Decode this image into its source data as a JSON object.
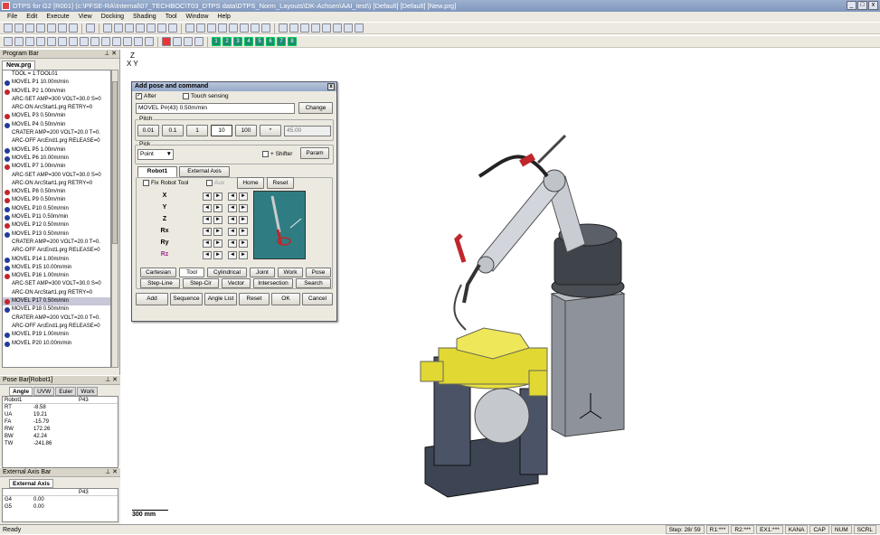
{
  "window": {
    "title": "DTPS for G2 [R001] (c:\\PFSE-RA\\Internal\\07_TECHBOC\\T03_DTPS data\\DTPS_Norm_Layouts\\DK-Achsen\\AAI_test\\) [Default] [Default] [New.prg]",
    "controls": [
      "_",
      "□",
      "x"
    ]
  },
  "menu": [
    "File",
    "Edit",
    "Execute",
    "View",
    "Docking",
    "Shading",
    "Tool",
    "Window",
    "Help"
  ],
  "toolbar2_numbers": [
    "1",
    "2",
    "3",
    "4",
    "5",
    "6",
    "7",
    "8"
  ],
  "program_bar": {
    "title": "Program Bar",
    "tab": "New.prg",
    "lines": [
      {
        "text": "TOOL = 1:TOOL01",
        "dot": ""
      },
      {
        "text": "MOVEL P1 10.00m/min",
        "dot": "blue"
      },
      {
        "text": "MOVEL P2 1.00m/min",
        "dot": "red"
      },
      {
        "text": "ARC-SET AMP=300 VOLT=30.0 S=0",
        "dot": ""
      },
      {
        "text": "ARC-ON ArcStart1.prg RETRY=0",
        "dot": ""
      },
      {
        "text": "MOVEL P3 0.50m/min",
        "dot": "red"
      },
      {
        "text": "MOVEL P4 0.50m/min",
        "dot": "blue"
      },
      {
        "text": "CRATER AMP=200 VOLT=20.0 T=0.",
        "dot": ""
      },
      {
        "text": "ARC-OFF ArcEnd1.prg RELEASE=0",
        "dot": ""
      },
      {
        "text": "MOVEL P5 1.00m/min",
        "dot": "blue"
      },
      {
        "text": "MOVEL P6 10.00m/min",
        "dot": "blue"
      },
      {
        "text": "MOVEL P7 1.00m/min",
        "dot": "red"
      },
      {
        "text": "ARC-SET AMP=300 VOLT=30.0 S=0",
        "dot": ""
      },
      {
        "text": "ARC-ON ArcStart1.prg RETRY=0",
        "dot": ""
      },
      {
        "text": "MOVEL P8 0.50m/min",
        "dot": "red"
      },
      {
        "text": "MOVEL P9 0.50m/min",
        "dot": "red"
      },
      {
        "text": "MOVEL P10 0.50m/min",
        "dot": "blue"
      },
      {
        "text": "MOVEL P11 0.50m/min",
        "dot": "blue"
      },
      {
        "text": "MOVEL P12 0.50m/min",
        "dot": "red"
      },
      {
        "text": "MOVEL P13 0.50m/min",
        "dot": "blue"
      },
      {
        "text": "CRATER AMP=200 VOLT=20.0 T=0.",
        "dot": ""
      },
      {
        "text": "ARC-OFF ArcEnd1.prg RELEASE=0",
        "dot": ""
      },
      {
        "text": "MOVEL P14 1.00m/min",
        "dot": "blue"
      },
      {
        "text": "MOVEL P15 10.00m/min",
        "dot": "blue"
      },
      {
        "text": "MOVEL P16 1.00m/min",
        "dot": "red"
      },
      {
        "text": "ARC-SET AMP=300 VOLT=30.0 S=0",
        "dot": ""
      },
      {
        "text": "ARC-ON ArcStart1.prg RETRY=0",
        "dot": ""
      },
      {
        "text": "MOVEL P17 0.50m/min",
        "dot": "red",
        "selected": true
      },
      {
        "text": "MOVEL P18 0.50m/min",
        "dot": "blue"
      },
      {
        "text": "CRATER AMP=200 VOLT=20.0 T=0.",
        "dot": ""
      },
      {
        "text": "ARC-OFF ArcEnd1.prg RELEASE=0",
        "dot": ""
      },
      {
        "text": "MOVEL P19 1.00m/min",
        "dot": "blue"
      },
      {
        "text": "MOVEL P20 10.00m/min",
        "dot": "blue"
      }
    ]
  },
  "pose_bar": {
    "title": "Pose Bar[Robot1]",
    "tabs": [
      "Angle",
      "UVW",
      "Euler",
      "Work"
    ],
    "active_tab": "Angle",
    "header": [
      "Robot1",
      "",
      "P43"
    ],
    "rows": [
      [
        "RT",
        "-8.58"
      ],
      [
        "UA",
        "19.21"
      ],
      [
        "FA",
        "-15.79"
      ],
      [
        "RW",
        "172.26"
      ],
      [
        "BW",
        "42.24"
      ],
      [
        "TW",
        "-241.86"
      ]
    ]
  },
  "ext_axis_bar": {
    "title": "External Axis Bar",
    "tab": "External Axis",
    "header": [
      "",
      "",
      "P43"
    ],
    "rows": [
      [
        "G4",
        "0.00"
      ],
      [
        "G5",
        "0.00"
      ]
    ]
  },
  "viewport": {
    "axis_z": "Z",
    "axis_xy": "X Y",
    "scale": "300 mm"
  },
  "dialog": {
    "title": "Add pose and command",
    "after_label": "After",
    "touch_label": "Touch sensing",
    "command_value": "MOVEL P#(43) 0.50m/min",
    "change": "Change",
    "pitch_label": "Pitch",
    "pitch_buttons": [
      "0.01",
      "0.1",
      "1",
      "10",
      "100",
      "*"
    ],
    "pitch_value": "45.00",
    "pick_label": "Pick",
    "pick_value": "Point",
    "shifter_label": "+ Shifter",
    "param": "Param",
    "tab_robot": "Robot1",
    "tab_ext": "External Axis",
    "fix_tool": "Fix Robot Tool",
    "aux": "Aux",
    "home": "Home",
    "reset_top": "Reset",
    "axes": [
      "X",
      "Y",
      "Z",
      "Rx",
      "Ry",
      "Rz"
    ],
    "coord_row1": [
      "Cartesian",
      "Tool",
      "Cylindrical",
      "Joint",
      "Work",
      "Pose"
    ],
    "coord_row2": [
      "Step-Line",
      "Step-Cir",
      "Vector",
      "Intersection",
      "Search"
    ],
    "bottom": [
      "Add",
      "Sequence",
      "Angle List",
      "Reset",
      "OK",
      "Cancel"
    ]
  },
  "status": {
    "ready": "Ready",
    "step": "Step: 28/ 59",
    "r1": "R1:***",
    "r2": "R2:***",
    "ex": "EX1:***",
    "kana": "KANA",
    "cap": "CAP",
    "num": "NUM",
    "scrl": "SCRL"
  },
  "colors": {
    "red_dot": "#c0262c",
    "blue_dot": "#1f3c9a",
    "robot_gray": "#c9cdd3",
    "workpiece_yellow": "#e8df3c",
    "preview_bg": "#2f7d82"
  }
}
